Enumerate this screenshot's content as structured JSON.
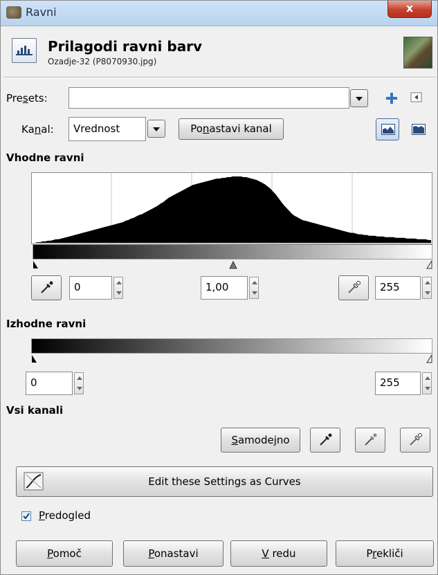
{
  "window": {
    "title": "Ravni",
    "close": "x"
  },
  "header": {
    "title": "Prilagodi ravni barv",
    "subtitle": "Ozadje-32 (P8070930.jpg)"
  },
  "presets": {
    "label_pre": "Pre",
    "label_u": "s",
    "label_post": "ets:",
    "value": ""
  },
  "channel": {
    "label_pre": "Ka",
    "label_u": "n",
    "label_post": "al:",
    "value": "Vrednost",
    "reset_pre": "Po",
    "reset_u": "n",
    "reset_post": "astavi kanal"
  },
  "input": {
    "section": "Vhodne ravni",
    "low": "0",
    "gamma": "1,00",
    "high": "255"
  },
  "output": {
    "section": "Izhodne ravni",
    "low": "0",
    "high": "255"
  },
  "all_channels": {
    "section": "Vsi kanali",
    "auto_u": "S",
    "auto_post": "amodejno"
  },
  "curves_button": "Edit these Settings as Curves",
  "preview": {
    "checked": true,
    "label_u": "P",
    "label_post": "redogled"
  },
  "buttons": {
    "help_u": "P",
    "help_post": "omoč",
    "reset_u": "P",
    "reset_post": "onastavi",
    "ok_u": "V",
    "ok_post": " redu",
    "cancel_pre": "P",
    "cancel_u": "r",
    "cancel_post": "ekliči"
  },
  "histogram": {
    "levels": [
      0,
      0,
      1,
      1,
      2,
      2,
      3,
      3,
      4,
      5,
      5,
      6,
      7,
      8,
      9,
      10,
      11,
      12,
      13,
      14,
      15,
      16,
      17,
      18,
      19,
      20,
      21,
      22,
      23,
      24,
      25,
      26,
      27,
      28,
      29,
      31,
      32,
      34,
      35,
      37,
      39,
      40,
      42,
      44,
      46,
      48,
      50,
      52,
      55,
      57,
      60,
      63,
      65,
      67,
      69,
      71,
      73,
      75,
      77,
      79,
      81,
      82,
      83,
      84,
      85,
      86,
      87,
      88,
      89,
      90,
      90,
      91,
      91,
      92,
      92,
      93,
      93,
      93,
      93,
      92,
      92,
      91,
      90,
      89,
      88,
      86,
      84,
      82,
      79,
      76,
      72,
      68,
      63,
      58,
      53,
      49,
      45,
      41,
      38,
      36,
      34,
      32,
      31,
      30,
      29,
      28,
      27,
      26,
      25,
      24,
      23,
      22,
      21,
      20,
      19,
      18,
      17,
      16,
      15,
      14,
      14,
      13,
      12,
      12,
      11,
      11,
      10,
      10,
      10,
      9,
      9,
      9,
      8,
      8,
      8,
      8,
      7,
      7,
      7,
      7,
      6,
      6,
      6,
      6,
      5,
      5,
      5,
      5,
      4,
      4
    ]
  }
}
